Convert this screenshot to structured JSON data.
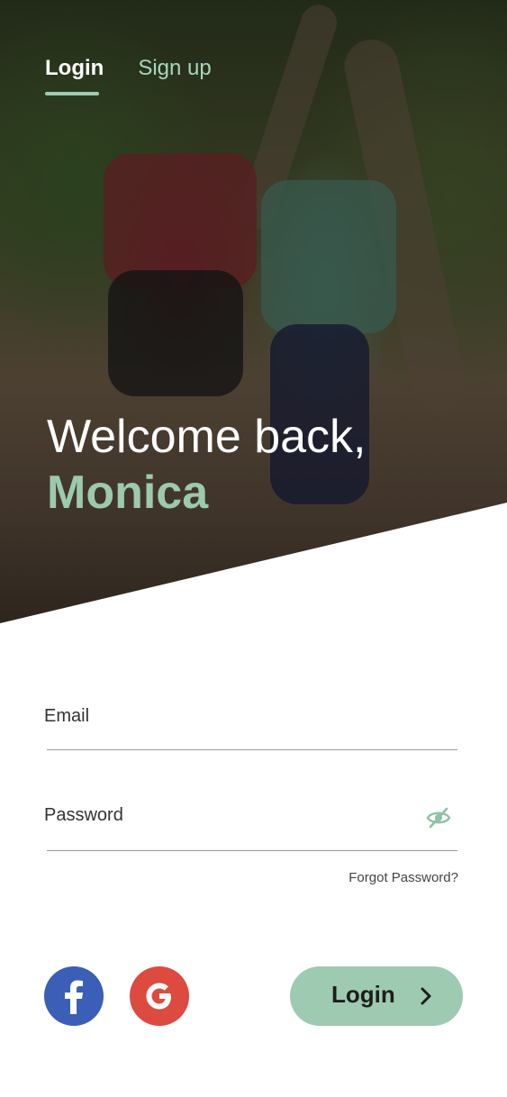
{
  "tabs": {
    "login_label": "Login",
    "signup_label": "Sign up"
  },
  "hero": {
    "greeting": "Welcome back,",
    "user_name": "Monica"
  },
  "form": {
    "email_label": "Email",
    "password_label": "Password",
    "forgot_password": "Forgot Password?"
  },
  "social": {
    "facebook_icon": "facebook-icon",
    "google_icon": "google-icon",
    "facebook_color": "#3b5fb7",
    "google_color": "#dd4a3f"
  },
  "actions": {
    "login_label": "Login"
  },
  "colors": {
    "accent": "#9dcab1",
    "tab_inactive": "#a9d6bc"
  }
}
